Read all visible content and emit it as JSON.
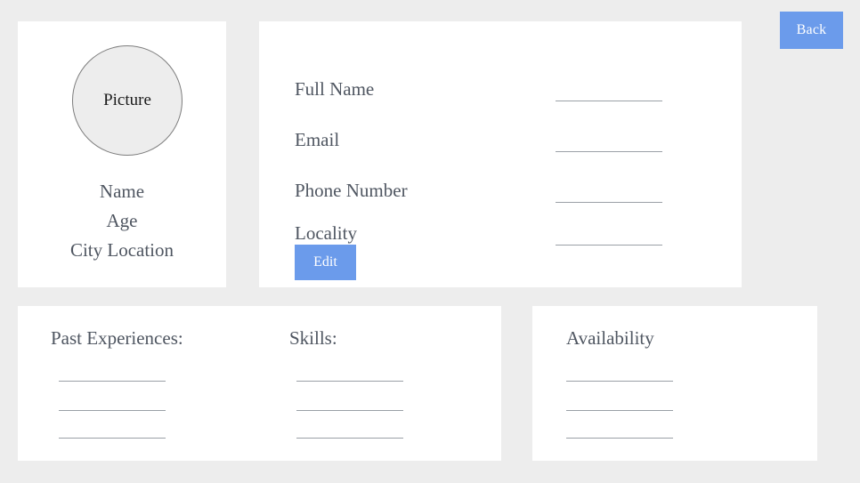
{
  "header": {
    "back_label": "Back"
  },
  "profile": {
    "picture_placeholder": "Picture",
    "lines": [
      "Name",
      "Age",
      "City Location"
    ]
  },
  "details": {
    "fields": [
      {
        "label": "Full Name",
        "value": "",
        "placeholder": ""
      },
      {
        "label": "Email",
        "value": "",
        "placeholder": ""
      },
      {
        "label": "Phone Number",
        "value": "",
        "placeholder": ""
      },
      {
        "label": "Locality",
        "value": "",
        "placeholder": ""
      }
    ],
    "edit_label": "Edit"
  },
  "experience": {
    "past_experiences_heading": "Past Experiences:",
    "past_experiences_entries": [
      "",
      "",
      ""
    ],
    "skills_heading": "Skills:",
    "skills_entries": [
      "",
      "",
      ""
    ]
  },
  "availability": {
    "heading": "Availability",
    "entries": [
      "",
      "",
      ""
    ]
  },
  "colors": {
    "background": "#ededed",
    "card": "#ffffff",
    "accent": "#6b9beb",
    "text": "#4f5661",
    "rule": "#9aa0a6"
  }
}
